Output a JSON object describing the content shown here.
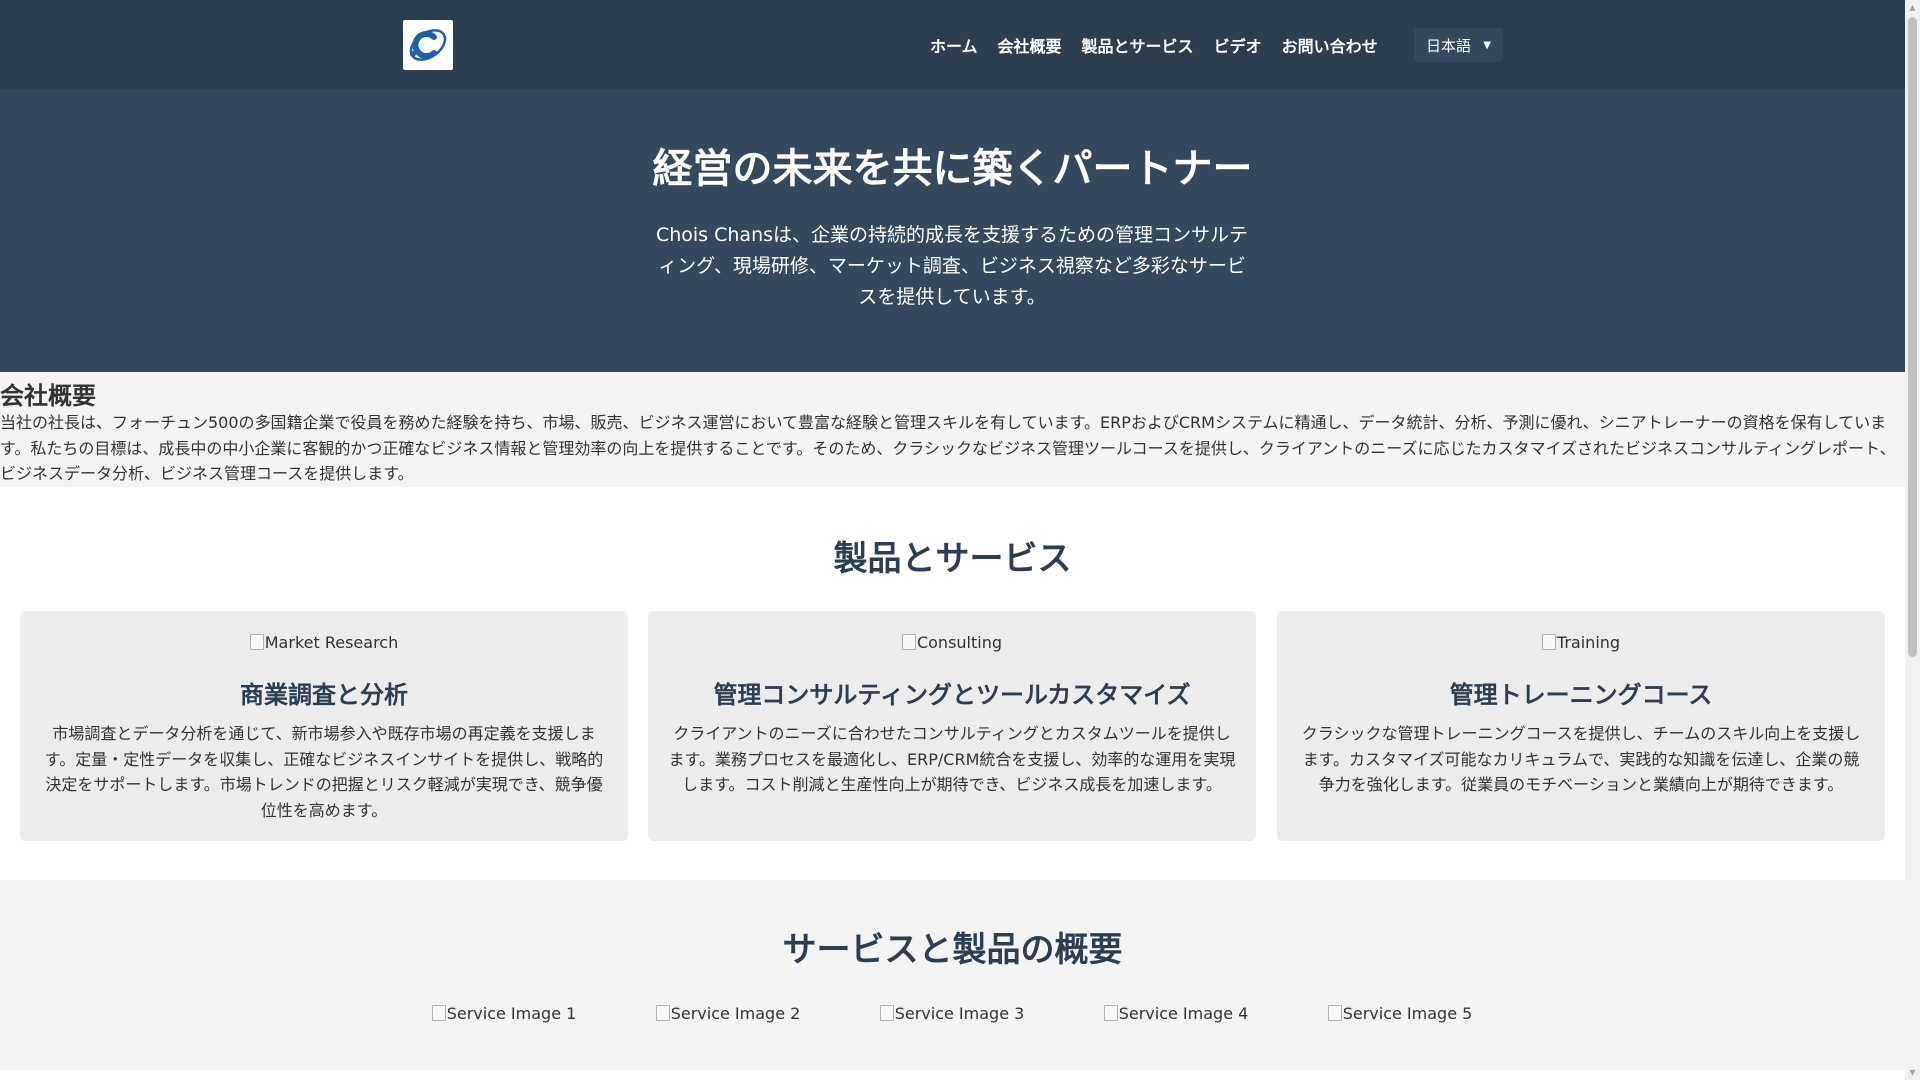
{
  "nav": {
    "logo_letter": "C",
    "links": [
      "ホーム",
      "会社概要",
      "製品とサービス",
      "ビデオ",
      "お問い合わせ"
    ],
    "language": "日本語",
    "colors": {
      "background": "#2c3e50",
      "text": "#ffffff"
    }
  },
  "hero": {
    "title": "経営の未来を共に築くパートナー",
    "description": "Chois Chansは、企業の持続的成長を支援するための管理コンサルティング、現場研修、マーケット調査、ビジネス視察など多彩なサービスを提供しています。",
    "background": "#34495e"
  },
  "about": {
    "heading": "会社概要",
    "body": "当社の社長は、フォーチュン500の多国籍企業で役員を務めた経験を持ち、市場、販売、ビジネス運営において豊富な経験と管理スキルを有しています。ERPおよびCRMシステムに精通し、データ統計、分析、予測に優れ、シニアトレーナーの資格を保有しています。私たちの目標は、成長中の中小企業に客観的かつ正確なビジネス情報と管理効率の向上を提供することです。そのため、クラシックなビジネス管理ツールコースを提供し、クライアントのニーズに応じたカスタマイズされたビジネスコンサルティングレポート、ビジネスデータ分析、ビジネス管理コースを提供します。"
  },
  "products": {
    "heading": "製品とサービス",
    "cards": [
      {
        "image_alt": "Market Research",
        "title": "商業調査と分析",
        "text": "市場調査とデータ分析を通じて、新市場参入や既存市場の再定義を支援します。定量・定性データを収集し、正確なビジネスインサイトを提供し、戦略的決定をサポートします。市場トレンドの把握とリスク軽減が実現でき、競争優位性を高めます。"
      },
      {
        "image_alt": "Consulting",
        "title": "管理コンサルティングとツールカスタマイズ",
        "text": "クライアントのニーズに合わせたコンサルティングとカスタムツールを提供します。業務プロセスを最適化し、ERP/CRM統合を支援し、効率的な運用を実現します。コスト削減と生産性向上が期待でき、ビジネス成長を加速します。"
      },
      {
        "image_alt": "Training",
        "title": "管理トレーニングコース",
        "text": "クラシックな管理トレーニングコースを提供し、チームのスキル向上を支援します。カスタマイズ可能なカリキュラムで、実践的な知識を伝達し、企業の競争力を強化します。従業員のモチベーションと業績向上が期待できます。"
      }
    ]
  },
  "overview": {
    "heading": "サービスと製品の概要",
    "images": [
      "Service Image 1",
      "Service Image 2",
      "Service Image 3",
      "Service Image 4",
      "Service Image 5"
    ]
  }
}
